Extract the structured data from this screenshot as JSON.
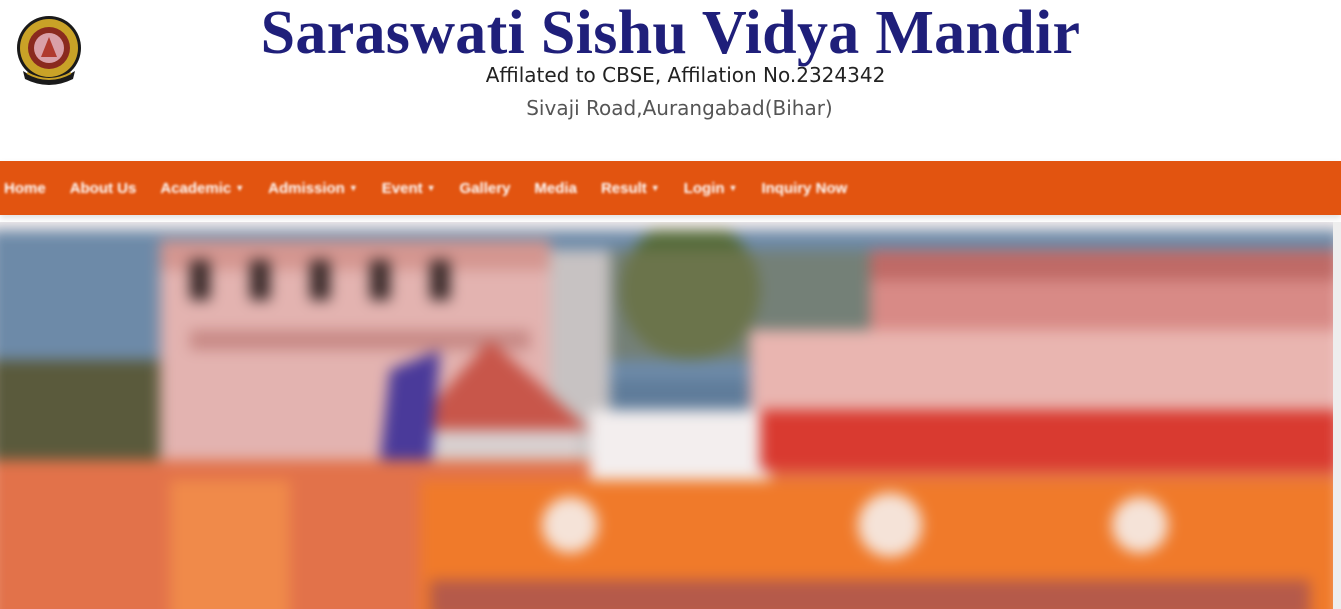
{
  "header": {
    "title": "Saraswati Sishu Vidya Mandir",
    "affiliation": "Affilated to CBSE, Affilation No.2324342",
    "address": "Sivaji Road,Aurangabad(Bihar)"
  },
  "nav": {
    "items": [
      {
        "label": "Home",
        "dropdown": false
      },
      {
        "label": "About Us",
        "dropdown": false
      },
      {
        "label": "Academic",
        "dropdown": true
      },
      {
        "label": "Admission",
        "dropdown": true
      },
      {
        "label": "Event",
        "dropdown": true
      },
      {
        "label": "Gallery",
        "dropdown": false
      },
      {
        "label": "Media",
        "dropdown": false
      },
      {
        "label": "Result",
        "dropdown": true
      },
      {
        "label": "Login",
        "dropdown": true
      },
      {
        "label": "Inquiry Now",
        "dropdown": false
      }
    ]
  },
  "colors": {
    "title": "#1f1f7a",
    "navbar": "#e25410",
    "banner_orange": "#f07a2a"
  },
  "icons": {
    "caret": "chevron-down-icon",
    "logo": "school-logo"
  }
}
